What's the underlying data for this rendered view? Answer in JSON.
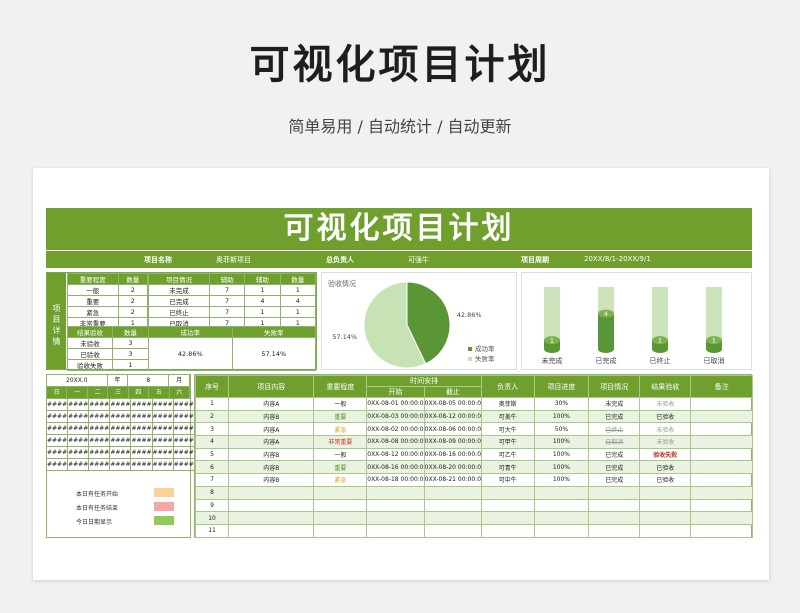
{
  "hero": {
    "title": "可视化项目计划",
    "subtitle": "简单易用 / 自动统计 / 自动更新"
  },
  "sheet": {
    "title": "可视化项目计划",
    "info": {
      "project_name_label": "项目名称",
      "project_name": "奥菲斯项目",
      "owner_label": "总负责人",
      "owner": "可强牛",
      "period_label": "项目周期",
      "period": "20XX/8/1-20XX/9/1"
    }
  },
  "detail": {
    "side_label": [
      "项",
      "目",
      "详",
      "情"
    ],
    "importance": {
      "headers": [
        "重要程度",
        "数量"
      ],
      "rows": [
        [
          "一般",
          "2"
        ],
        [
          "重要",
          "2"
        ],
        [
          "紧急",
          "2"
        ],
        [
          "非常重要",
          "1"
        ]
      ]
    },
    "status": {
      "headers": [
        "项目情况",
        "辅助",
        "辅助",
        "数量"
      ],
      "rows": [
        [
          "未完成",
          "7",
          "1",
          "1"
        ],
        [
          "已完成",
          "7",
          "4",
          "4"
        ],
        [
          "已终止",
          "7",
          "1",
          "1"
        ],
        [
          "已取消",
          "7",
          "1",
          "1"
        ]
      ]
    },
    "acceptance": {
      "headers": [
        "结果验收",
        "数量",
        "成功率",
        "失败率"
      ],
      "rows": [
        [
          "未验收",
          "3"
        ],
        [
          "已验收",
          "3"
        ],
        [
          "验收失败",
          "1"
        ]
      ],
      "success_rate": "42.86%",
      "fail_rate": "57.14%"
    }
  },
  "chart_data": [
    {
      "type": "pie",
      "title": "验收情况",
      "categories": [
        "成功率",
        "失败率"
      ],
      "values": [
        42.86,
        57.14
      ],
      "data_labels": [
        "42.86%",
        "57.14%"
      ],
      "legend": "right",
      "colors": [
        "#5a9636",
        "#c7e3b5"
      ]
    },
    {
      "type": "bar",
      "categories": [
        "未完成",
        "已完成",
        "已终止",
        "已取消"
      ],
      "values": [
        1,
        4,
        1,
        1
      ],
      "background_values": [
        7,
        7,
        7,
        7
      ],
      "colors": [
        "#5a9636",
        "#cde3bb"
      ]
    }
  ],
  "calendar": {
    "year": "20XX.0",
    "year_unit": "年",
    "month": "8",
    "month_unit": "月",
    "weekdays": [
      "日",
      "一",
      "二",
      "三",
      "四",
      "五",
      "六"
    ],
    "cell": "####"
  },
  "legend": {
    "items": [
      {
        "label": "本日有任务开始",
        "color": "#f9d29a"
      },
      {
        "label": "本日有任务结束",
        "color": "#f4a7a7"
      },
      {
        "label": "今日日期显示",
        "color": "#93c85c"
      }
    ]
  },
  "main_table": {
    "headers": [
      "序号",
      "项目内容",
      "重要程度",
      "时间安排",
      "负责人",
      "项目进度",
      "项目情况",
      "结果验收",
      "备注"
    ],
    "sub_headers": [
      "开始",
      "截止"
    ],
    "rows": [
      [
        "1",
        "内容A",
        "一般",
        "0XX-08-01 00:00:0",
        "0XX-08-05 00:00:0",
        "奥菲斯",
        "30%",
        "未完成",
        "未验收",
        ""
      ],
      [
        "2",
        "内容B",
        "重要",
        "0XX-08-03 00:00:0",
        "0XX-08-12 00:00:0",
        "可美牛",
        "100%",
        "已完成",
        "已验收",
        ""
      ],
      [
        "3",
        "内容A",
        "紧急",
        "0XX-08-02 00:00:0",
        "0XX-08-06 00:00:0",
        "可大牛",
        "50%",
        "已终止",
        "未验收",
        ""
      ],
      [
        "4",
        "内容A",
        "非常重要",
        "0XX-08-08 00:00:0",
        "0XX-08-09 00:00:0",
        "可甲牛",
        "100%",
        "已取消",
        "未验收",
        ""
      ],
      [
        "5",
        "内容B",
        "一般",
        "0XX-08-12 00:00:0",
        "0XX-08-16 00:00:0",
        "可乙牛",
        "100%",
        "已完成",
        "验收失败",
        ""
      ],
      [
        "6",
        "内容B",
        "重要",
        "0XX-08-16 00:00:0",
        "0XX-08-20 00:00:0",
        "可青牛",
        "100%",
        "已完成",
        "已验收",
        ""
      ],
      [
        "7",
        "内容B",
        "紧急",
        "0XX-08-18 00:00:0",
        "0XX-08-21 00:00:0",
        "可中牛",
        "100%",
        "已完成",
        "已验收",
        ""
      ],
      [
        "8",
        "",
        "",
        "",
        "",
        "",
        "",
        "",
        "",
        ""
      ],
      [
        "9",
        "",
        "",
        "",
        "",
        "",
        "",
        "",
        "",
        ""
      ],
      [
        "10",
        "",
        "",
        "",
        "",
        "",
        "",
        "",
        "",
        ""
      ],
      [
        "11",
        "",
        "",
        "",
        "",
        "",
        "",
        "",
        "",
        ""
      ]
    ]
  },
  "colors": {
    "accent": "#6f9f2d",
    "light": "#eaf3df",
    "importance_important": "#4f8f2a",
    "importance_urgent": "#d9a21b",
    "importance_critical": "#c0392b",
    "fail": "#c0392b"
  }
}
